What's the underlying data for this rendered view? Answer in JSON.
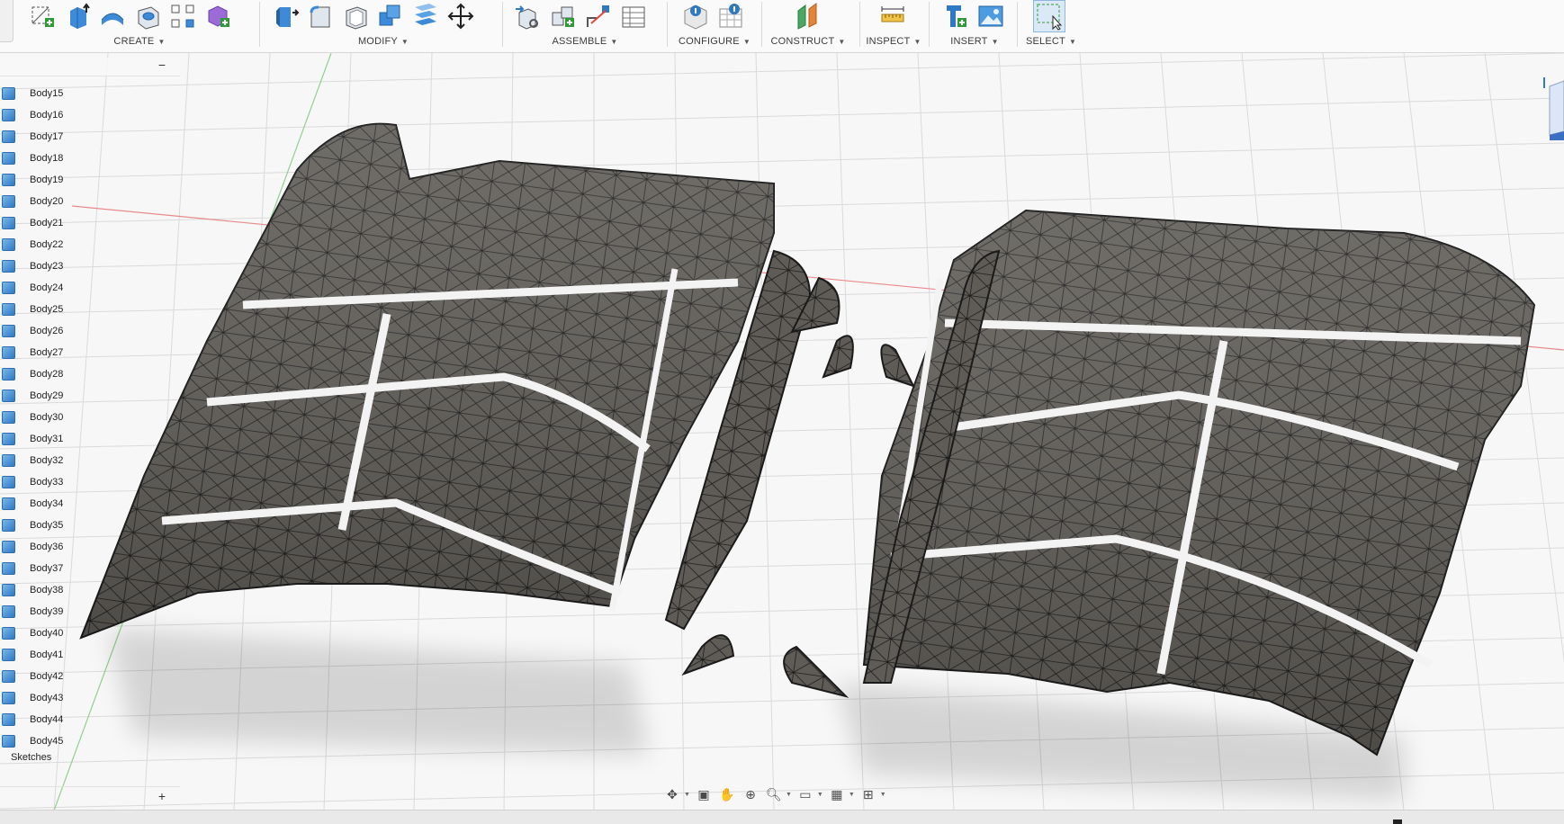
{
  "toolbar": {
    "groups": [
      {
        "id": "create",
        "label": "CREATE"
      },
      {
        "id": "modify",
        "label": "MODIFY"
      },
      {
        "id": "assemble",
        "label": "ASSEMBLE"
      },
      {
        "id": "configure",
        "label": "CONFIGURE"
      },
      {
        "id": "construct",
        "label": "CONSTRUCT"
      },
      {
        "id": "inspect",
        "label": "INSPECT"
      },
      {
        "id": "insert",
        "label": "INSERT"
      },
      {
        "id": "select",
        "label": "SELECT"
      }
    ]
  },
  "browser": {
    "collapse_symbol": "−",
    "bodies": [
      "Body15",
      "Body16",
      "Body17",
      "Body18",
      "Body19",
      "Body20",
      "Body21",
      "Body22",
      "Body23",
      "Body24",
      "Body25",
      "Body26",
      "Body27",
      "Body28",
      "Body29",
      "Body30",
      "Body31",
      "Body32",
      "Body33",
      "Body34",
      "Body35",
      "Body36",
      "Body37",
      "Body38",
      "Body39",
      "Body40",
      "Body41",
      "Body42",
      "Body43",
      "Body44",
      "Body45"
    ],
    "sketches_label": "Sketches",
    "add_symbol": "+"
  },
  "colors": {
    "mesh_fill": "#5b5853",
    "mesh_line": "#1c1c1c",
    "grid": "#d9d9d9",
    "x_axis": "#e98a8a",
    "y_axis": "#8fd08f",
    "body_icon": "#3a86d1"
  }
}
